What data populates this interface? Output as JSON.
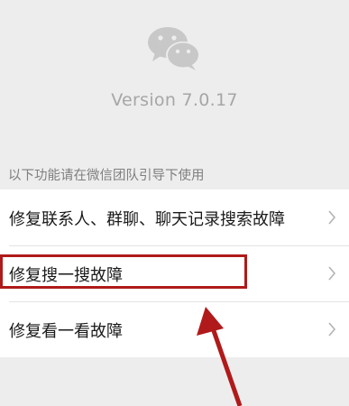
{
  "app": {
    "logo_icon": "wechat-logo-icon",
    "version_text": "Version 7.0.17"
  },
  "section": {
    "title": "以下功能请在微信团队引导下使用"
  },
  "items": [
    {
      "label": "修复联系人、群聊、聊天记录搜索故障",
      "icon": "chevron-right-icon"
    },
    {
      "label": "修复搜一搜故障",
      "icon": "chevron-right-icon"
    },
    {
      "label": "修复看一看故障",
      "icon": "chevron-right-icon"
    }
  ],
  "annotation": {
    "highlight_color": "#b01a1a",
    "arrow_color": "#b01a1a"
  }
}
